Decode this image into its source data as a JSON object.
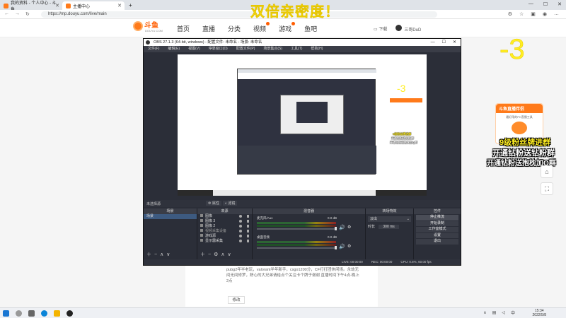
{
  "browser": {
    "tabs": [
      {
        "label": "我的资料 - 个人中心 - 斗鱼",
        "active": false
      },
      {
        "label": "主播中心",
        "active": true
      }
    ],
    "new_tab": "+",
    "url": "https://mp.douyu.com/live/main",
    "window_min": "—",
    "window_max": "☐",
    "window_close": "✕"
  },
  "site": {
    "logo": "斗鱼",
    "logo_sub": "DOUYU.COM",
    "nav": [
      "首页",
      "直播",
      "分类",
      "视频",
      "游戏",
      "鱼吧"
    ],
    "download": "下载",
    "username": "三哥DuD"
  },
  "overlays": {
    "headline": "双倍亲密度！",
    "countdown": "-3",
    "promo_title": "斗鱼直播伴侣",
    "promo_desc": "最好用的PC直播工具",
    "line1": "9级粉丝牌进群",
    "line2": "开通钻粉送钻粉群",
    "line3": "开通钻粉送抱枕加Q群"
  },
  "content": {
    "text": "pubg2年半老玩，valorant半年新手，csgo1200分，CF打打团休闲场。永劫无间无间修罗，舒心的大兄弟请给点个关注卡个牌子谢谢 直播时间下午4点-晚上2点",
    "edit": "修改"
  },
  "obs": {
    "title": "OBS 27.1.3 (64-bit, windows) - 配置文件: 未命名 - 场景: 未命名",
    "menu": [
      "文件(F)",
      "编辑(E)",
      "视图(V)",
      "停靠窗口(D)",
      "配置文件(P)",
      "场景集合(S)",
      "工具(T)",
      "帮助(H)"
    ],
    "no_source": "未选择源",
    "props": "属性",
    "filters": "滤镜",
    "docks": {
      "scenes": {
        "header": "场景",
        "items": [
          "场景"
        ]
      },
      "sources": {
        "header": "来源",
        "items": [
          "图像",
          "图像 3",
          "图像 2",
          "视频采集设备",
          "游戏源",
          "显示器采集"
        ]
      },
      "mixer": {
        "header": "混音器",
        "tracks": [
          {
            "name": "麦克风/Aux",
            "db": "0.0 dB"
          },
          {
            "name": "桌面音频",
            "db": "0.0 dB"
          }
        ]
      },
      "transitions": {
        "header": "转场特效",
        "type": "淡出",
        "duration_label": "时长",
        "duration": "300 ms"
      },
      "controls": {
        "header": "控件",
        "buttons": [
          "停止推流",
          "开始录制",
          "工作室模式",
          "设置",
          "退出"
        ]
      }
    },
    "status": {
      "live_label": "LIVE:",
      "live_time": "00:00:00",
      "rec_label": "REC:",
      "rec_time": "00:00:00",
      "cpu": "CPU: 0.5%, 60.00 fps"
    }
  },
  "taskbar": {
    "time": "15:34",
    "date": "2022/5/8",
    "lang": "中"
  }
}
